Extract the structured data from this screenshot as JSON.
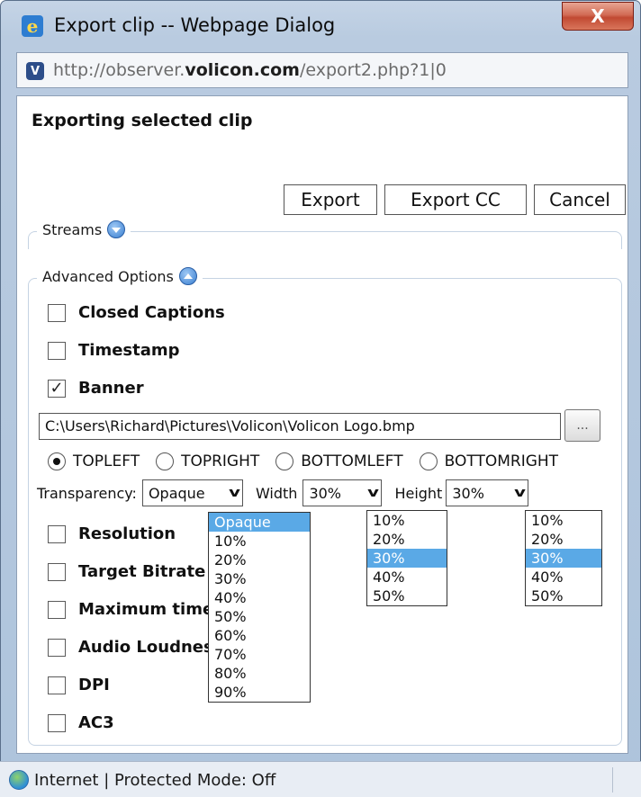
{
  "window": {
    "title": "Export clip -- Webpage Dialog",
    "close_label": "X"
  },
  "address": {
    "prefix": "http://observer.",
    "domain": "volicon.com",
    "suffix": "/export2.php?1|0"
  },
  "dialog": {
    "heading": "Exporting selected clip",
    "buttons": {
      "export": "Export",
      "export_cc": "Export CC",
      "cancel": "Cancel"
    },
    "streams_legend": "Streams",
    "advanced_legend": "Advanced Options",
    "options": {
      "closed_captions": {
        "label": "Closed Captions",
        "checked": false
      },
      "timestamp": {
        "label": "Timestamp",
        "checked": false
      },
      "banner": {
        "label": "Banner",
        "checked": true,
        "mark": "✓"
      },
      "resolution": {
        "label": "Resolution",
        "checked": false
      },
      "target_bitrate": {
        "label": "Target Bitrate",
        "checked": false
      },
      "maximum_time": {
        "label": "Maximum time",
        "checked": false
      },
      "audio_loudness": {
        "label": "Audio Loudness",
        "checked": false
      },
      "dpi": {
        "label": "DPI",
        "checked": false
      },
      "ac3": {
        "label": "AC3",
        "checked": false
      }
    },
    "banner_path": "C:\\Users\\Richard\\Pictures\\Volicon\\Volicon Logo.bmp",
    "browse_label": "...",
    "positions": [
      {
        "label": "TOPLEFT",
        "selected": true
      },
      {
        "label": "TOPRIGHT",
        "selected": false
      },
      {
        "label": "BOTTOMLEFT",
        "selected": false
      },
      {
        "label": "BOTTOMRIGHT",
        "selected": false
      }
    ],
    "transparency": {
      "label": "Transparency:",
      "value": "Opaque",
      "options": [
        "Opaque",
        "10%",
        "20%",
        "30%",
        "40%",
        "50%",
        "60%",
        "70%",
        "80%",
        "90%"
      ]
    },
    "width": {
      "label": "Width",
      "value": "30%",
      "options": [
        "10%",
        "20%",
        "30%",
        "40%",
        "50%"
      ]
    },
    "height": {
      "label": "Height",
      "value": "30%",
      "options": [
        "10%",
        "20%",
        "30%",
        "40%",
        "50%"
      ]
    }
  },
  "status": {
    "text": "Internet | Protected Mode: Off"
  },
  "colors": {
    "selection": "#5aa9e6",
    "frame": "#b9cbe0",
    "close_button": "#c14932"
  }
}
